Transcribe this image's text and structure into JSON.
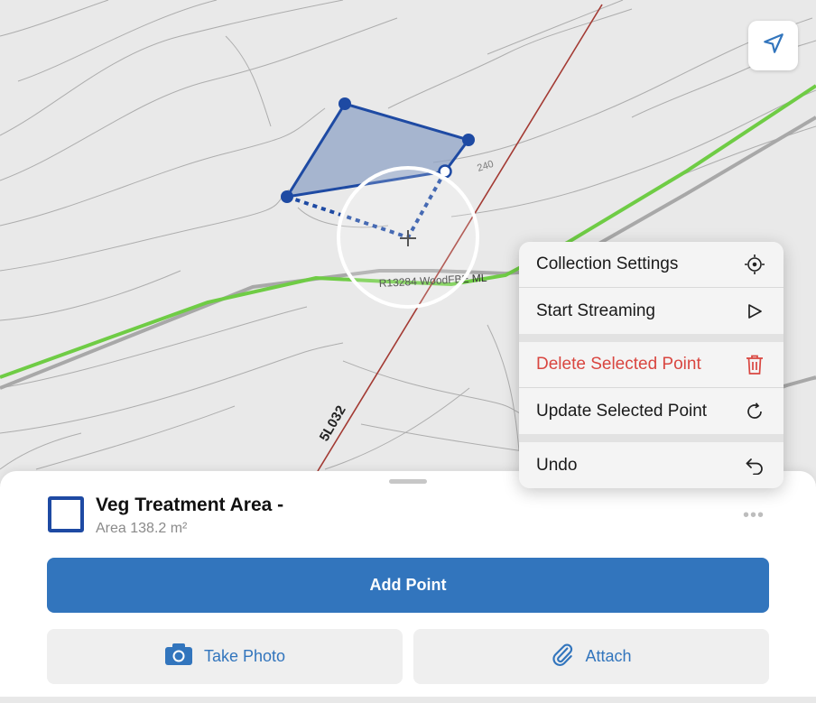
{
  "map": {
    "contour_label": "240",
    "road_label": "R13284 WoodFBE ML",
    "road_code": "5L032"
  },
  "locate_button": {
    "icon": "navigation-arrow-icon"
  },
  "context_menu": {
    "items": [
      {
        "label": "Collection Settings",
        "icon": "satellite-settings-icon"
      },
      {
        "label": "Start Streaming",
        "icon": "play-icon"
      },
      {
        "label": "Delete Selected Point",
        "icon": "trash-icon",
        "color": "#d94640"
      },
      {
        "label": "Update Selected Point",
        "icon": "refresh-icon"
      },
      {
        "label": "Undo",
        "icon": "undo-icon"
      }
    ]
  },
  "feature": {
    "title": "Veg Treatment Area -",
    "area_text": "Area 138.2 m²",
    "more": "•••"
  },
  "actions": {
    "add_point": "Add Point",
    "take_photo": "Take Photo",
    "attach": "Attach"
  },
  "colors": {
    "accent": "#3275bd",
    "polygon_stroke": "#1e4aa3",
    "polygon_fill": "#8fa3c6",
    "green_road": "#6fcc45",
    "red_line": "#a33a33",
    "destructive": "#d94640"
  }
}
